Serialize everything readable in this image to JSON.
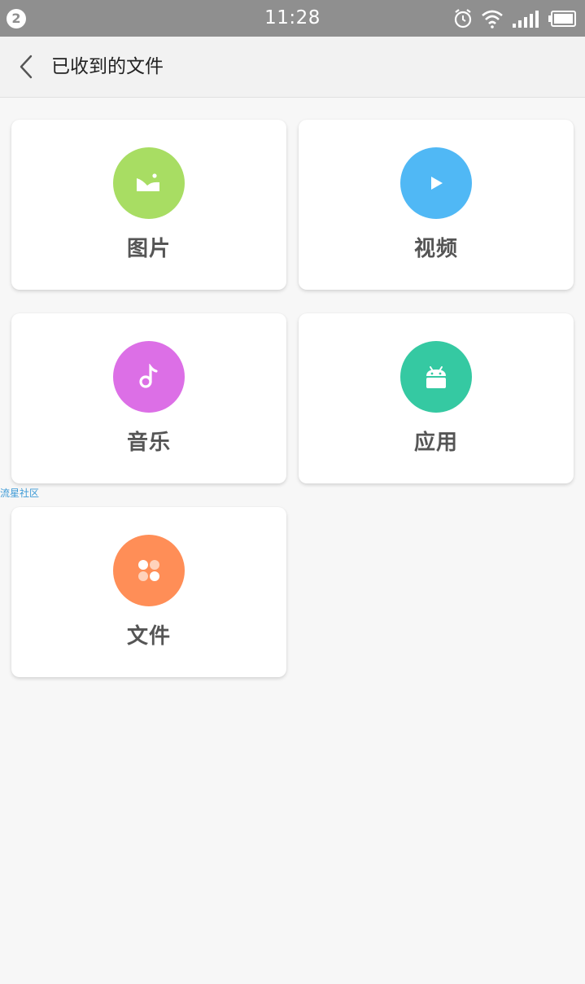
{
  "status_bar": {
    "notification_count": "2",
    "time": "11:28",
    "icons": [
      "alarm-icon",
      "wifi-icon",
      "signal-icon",
      "battery-icon"
    ]
  },
  "app_bar": {
    "back_icon": "chevron-left-icon",
    "title": "已收到的文件"
  },
  "categories": [
    {
      "label": "图片",
      "icon": "image-icon",
      "color": "#a8dd63"
    },
    {
      "label": "视频",
      "icon": "play-icon",
      "color": "#50b8f5"
    },
    {
      "label": "音乐",
      "icon": "music-note-icon",
      "color": "#dc6fe6"
    },
    {
      "label": "应用",
      "icon": "android-icon",
      "color": "#35c9a2"
    },
    {
      "label": "文件",
      "icon": "files-grid-icon",
      "color": "#ff8e57"
    }
  ],
  "watermark": "流星社区"
}
